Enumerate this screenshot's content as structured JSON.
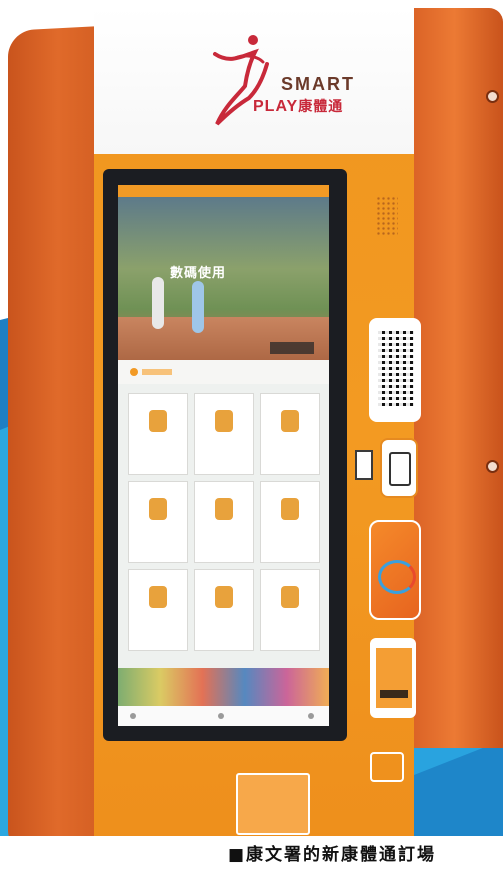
{
  "logo": {
    "brand_top": "SMART",
    "brand_bottom": "PLAY",
    "brand_cjk": "康體通"
  },
  "screen": {
    "hero_title": "數碼使用",
    "grid_items": [
      "",
      "",
      "",
      "",
      "",
      "",
      "",
      "",
      ""
    ]
  },
  "caption": {
    "text": "■康文署的新康體通訂場"
  },
  "colors": {
    "kiosk_orange": "#f29a22",
    "side_orange": "#d85f24",
    "blue_band": "#1e7fc4",
    "logo_red": "#c8293a"
  }
}
